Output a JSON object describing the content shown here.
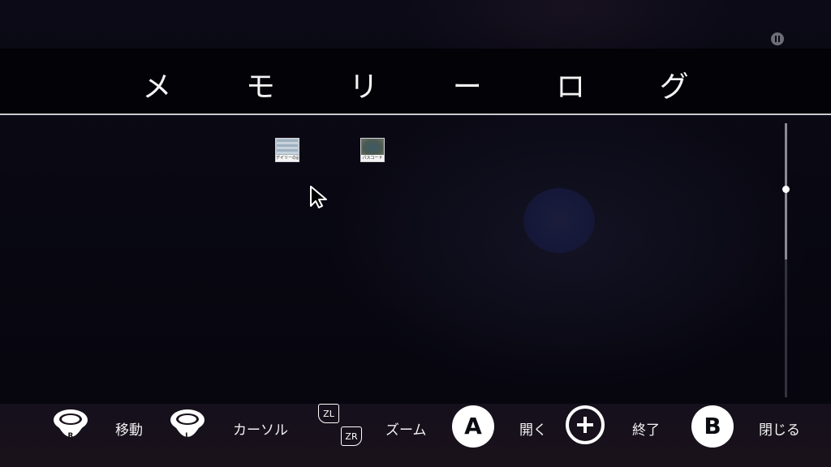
{
  "title": "メ モ リ ー ロ グ",
  "thumbnails": [
    {
      "caption": "デイリーの記録"
    },
    {
      "caption": "パスコード"
    }
  ],
  "icons": {
    "pause": "pause-icon",
    "cursor": "arrow-cursor-icon",
    "r_stick": "r-stick-icon",
    "l_stick": "l-stick-icon",
    "zl_zr": "zl-zr-buttons-icon",
    "plus": "plus-button-icon"
  },
  "footer": {
    "move_label": "移動",
    "r_stick_letter": "R",
    "cursor_label": "カーソル",
    "l_stick_letter": "L",
    "zl": "ZL",
    "zr": "ZR",
    "zoom_label": "ズーム",
    "a_letter": "A",
    "open_label": "開く",
    "quit_label": "終了",
    "b_letter": "B",
    "close_label": "閉じる"
  },
  "colors": {
    "background": "#07060f",
    "header_band": "#020207",
    "footer_bar": "#1a121b",
    "accent": "#ffffff"
  },
  "scroll": {
    "position": 0.24
  }
}
